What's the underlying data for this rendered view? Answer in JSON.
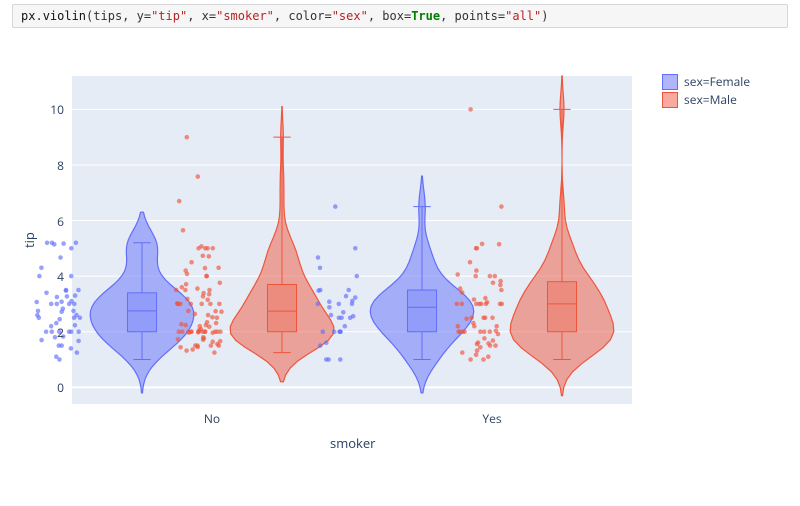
{
  "code": {
    "tokens": [
      {
        "t": "px",
        "cls": "tok-id"
      },
      {
        "t": ".",
        "cls": "tok-punc"
      },
      {
        "t": "violin",
        "cls": "tok-fn"
      },
      {
        "t": "(tips, y=",
        "cls": "tok-punc"
      },
      {
        "t": "\"tip\"",
        "cls": "tok-str"
      },
      {
        "t": ", x=",
        "cls": "tok-punc"
      },
      {
        "t": "\"smoker\"",
        "cls": "tok-str"
      },
      {
        "t": ", color=",
        "cls": "tok-punc"
      },
      {
        "t": "\"sex\"",
        "cls": "tok-str"
      },
      {
        "t": ", box=",
        "cls": "tok-punc"
      },
      {
        "t": "True",
        "cls": "tok-kw"
      },
      {
        "t": ", points=",
        "cls": "tok-punc"
      },
      {
        "t": "\"all\"",
        "cls": "tok-str"
      },
      {
        "t": ")",
        "cls": "tok-punc"
      }
    ]
  },
  "legend": {
    "items": [
      {
        "label": "sex=Female",
        "color": "#636efa"
      },
      {
        "label": "sex=Male",
        "color": "#ef553b"
      }
    ]
  },
  "axes": {
    "x_title": "smoker",
    "y_title": "tip",
    "x_categories": [
      "No",
      "Yes"
    ],
    "y_ticks": [
      0,
      2,
      4,
      6,
      8,
      10
    ],
    "y_range": [
      -0.6,
      11.2
    ]
  },
  "colors": {
    "panel_bg": "#e5ecf6",
    "female": "#636efa",
    "male": "#ef553b",
    "grid": "#ffffff"
  },
  "chart_data": {
    "type": "violin",
    "title": "",
    "xlabel": "smoker",
    "ylabel": "tip",
    "x_categories": [
      "No",
      "Yes"
    ],
    "ylim": [
      -0.6,
      11.2
    ],
    "box": true,
    "points": "all",
    "series": [
      {
        "name": "sex=Female",
        "color": "#636efa",
        "groups": {
          "No": {
            "box": {
              "min": 1.0,
              "q1": 2.0,
              "median": 2.75,
              "q3": 3.4,
              "max": 5.2
            },
            "violin_extent": [
              -0.2,
              6.3
            ],
            "points": [
              1.0,
              1.1,
              1.25,
              1.4,
              1.5,
              1.5,
              1.67,
              1.7,
              1.8,
              1.83,
              2.0,
              2.0,
              2.0,
              2.0,
              2.0,
              2.0,
              2.2,
              2.23,
              2.31,
              2.45,
              2.5,
              2.5,
              2.5,
              2.6,
              2.6,
              2.72,
              2.75,
              2.75,
              2.83,
              3.0,
              3.0,
              3.0,
              3.0,
              3.07,
              3.08,
              3.1,
              3.25,
              3.27,
              3.3,
              3.4,
              3.48,
              3.5,
              3.5,
              4.0,
              4.0,
              4.3,
              4.67,
              5.0,
              5.14,
              5.17,
              5.2,
              5.2,
              5.2
            ]
          },
          "Yes": {
            "box": {
              "min": 1.0,
              "q1": 2.0,
              "median": 2.88,
              "q3": 3.5,
              "max": 6.5
            },
            "violin_extent": [
              -0.2,
              7.6
            ],
            "points": [
              1.0,
              1.0,
              1.0,
              1.5,
              1.6,
              2.0,
              2.0,
              2.0,
              2.0,
              2.0,
              2.2,
              2.5,
              2.5,
              2.5,
              2.56,
              2.6,
              2.7,
              2.88,
              3.0,
              3.0,
              3.0,
              3.08,
              3.11,
              3.23,
              3.28,
              3.48,
              3.5,
              3.5,
              4.0,
              4.3,
              4.67,
              5.0,
              6.5
            ]
          }
        }
      },
      {
        "name": "sex=Male",
        "color": "#ef553b",
        "groups": {
          "No": {
            "box": {
              "min": 1.25,
              "q1": 2.0,
              "median": 2.74,
              "q3": 3.7,
              "max": 9.0
            },
            "violin_extent": [
              0.2,
              10.1
            ],
            "points": [
              1.25,
              1.32,
              1.36,
              1.44,
              1.45,
              1.5,
              1.5,
              1.5,
              1.5,
              1.56,
              1.64,
              1.66,
              1.71,
              1.73,
              1.76,
              1.8,
              1.96,
              1.97,
              1.98,
              2.0,
              2.0,
              2.0,
              2.0,
              2.0,
              2.0,
              2.0,
              2.0,
              2.0,
              2.0,
              2.0,
              2.0,
              2.05,
              2.09,
              2.18,
              2.2,
              2.24,
              2.24,
              2.27,
              2.31,
              2.34,
              2.5,
              2.52,
              2.6,
              2.64,
              2.72,
              2.74,
              2.75,
              3.0,
              3.0,
              3.0,
              3.0,
              3.0,
              3.0,
              3.0,
              3.02,
              3.15,
              3.18,
              3.27,
              3.35,
              3.39,
              3.5,
              3.5,
              3.5,
              3.55,
              3.6,
              3.71,
              3.76,
              4.0,
              4.0,
              4.08,
              4.2,
              4.29,
              4.3,
              4.5,
              4.71,
              4.73,
              5.0,
              5.0,
              5.0,
              5.0,
              5.07,
              5.65,
              6.7,
              7.58,
              9.0
            ]
          },
          "Yes": {
            "box": {
              "min": 1.0,
              "q1": 2.0,
              "median": 3.0,
              "q3": 3.8,
              "max": 10.0
            },
            "violin_extent": [
              -0.3,
              11.2
            ],
            "points": [
              1.0,
              1.0,
              1.1,
              1.17,
              1.25,
              1.32,
              1.44,
              1.5,
              1.5,
              1.56,
              1.58,
              1.61,
              1.68,
              1.76,
              1.92,
              2.0,
              2.0,
              2.0,
              2.0,
              2.0,
              2.0,
              2.0,
              2.03,
              2.2,
              2.2,
              2.2,
              2.31,
              2.47,
              2.5,
              2.5,
              2.5,
              2.5,
              3.0,
              3.0,
              3.0,
              3.0,
              3.0,
              3.0,
              3.0,
              3.0,
              3.06,
              3.16,
              3.21,
              3.41,
              3.5,
              3.55,
              3.68,
              3.76,
              3.82,
              4.0,
              4.0,
              4.0,
              4.06,
              4.2,
              4.5,
              5.0,
              5.0,
              5.15,
              5.16,
              6.5,
              10.0
            ]
          }
        }
      }
    ]
  }
}
